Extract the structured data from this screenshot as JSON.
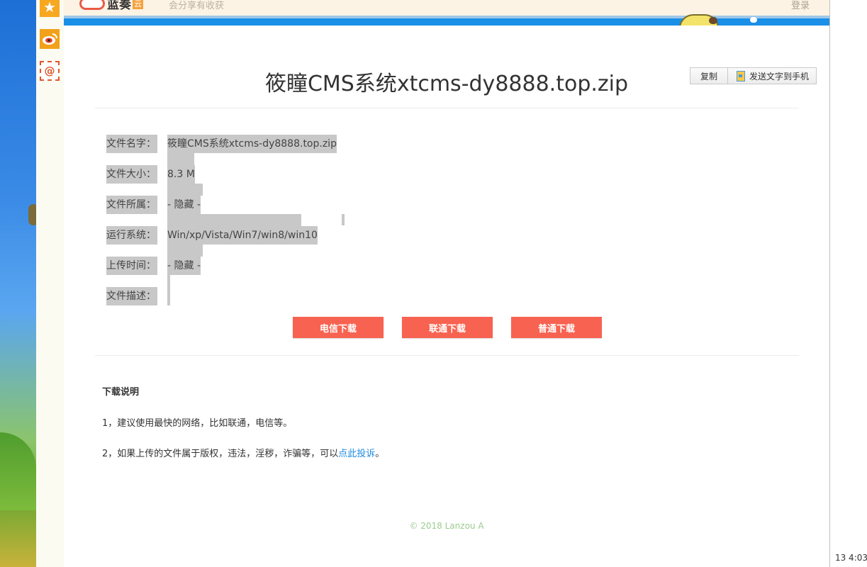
{
  "header": {
    "logo_text": "蓝奏",
    "logo_badge": "云",
    "slogan": "会分享有收获",
    "login_label": "登录"
  },
  "sidebar": {
    "items": [
      "star-icon",
      "weibo-icon",
      "email-icon"
    ],
    "mail_glyph": "@"
  },
  "toolbar": {
    "copy_label": "复制",
    "send_label": "发送文字到手机"
  },
  "file": {
    "title": "筱瞳CMS系统xtcms-dy8888.top.zip",
    "fields": [
      {
        "label": "文件名字：",
        "value": "筱瞳CMS系统xtcms-dy8888.top.zip"
      },
      {
        "label": "文件大小：",
        "value": "8.3 M"
      },
      {
        "label": "文件所属：",
        "value": "- 隐藏 -"
      },
      {
        "label": "运行系统：",
        "value": "Win/xp/Vista/Win7/win8/win10"
      },
      {
        "label": "上传时间：",
        "value": "- 隐藏 -"
      },
      {
        "label": "文件描述：",
        "value": ""
      }
    ]
  },
  "downloads": {
    "telecom": "电信下载",
    "unicom": "联通下载",
    "normal": "普通下载",
    "button_color": "#f86250"
  },
  "notes": {
    "title": "下载说明",
    "line1": "1，建议使用最快的网络，比如联通，电信等。",
    "line2_prefix": "2，如果上传的文件属于版权，违法，淫秽，诈骗等，可以",
    "line2_link": "点此投诉",
    "line2_suffix": "。"
  },
  "footer": "© 2018 Lanzou A",
  "taskbar": {
    "clock": "13 4:03"
  }
}
